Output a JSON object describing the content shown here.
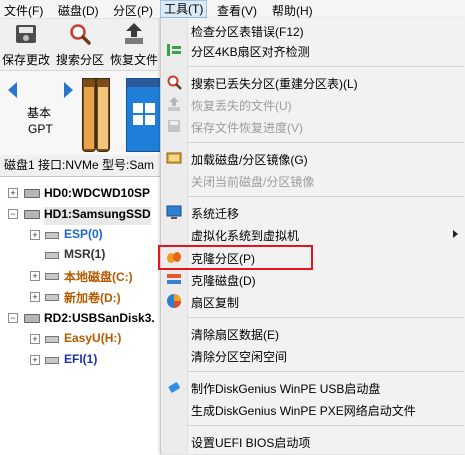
{
  "menubar": {
    "file": "文件(F)",
    "disk": "磁盘(D)",
    "partition": "分区(P)",
    "tools": "工具(T)",
    "view": "查看(V)",
    "help": "帮助(H)"
  },
  "toolbar": {
    "save": "保存更改",
    "search": "搜索分区",
    "restore": "恢复文件"
  },
  "disk_panel": {
    "basic": "基本",
    "gpt": "GPT",
    "info": "磁盘1 接口:NVMe  型号:Sam"
  },
  "tree": [
    {
      "label": "HD0:WDCWD10SP",
      "color": "#000000",
      "bold": true
    },
    {
      "label": "HD1:SamsungSSD",
      "color": "#000000",
      "bold": true
    },
    {
      "label": "ESP(0)",
      "color": "#1a66cc",
      "bold": true
    },
    {
      "label": "MSR(1)",
      "color": "#333333",
      "bold": true
    },
    {
      "label": "本地磁盘(C:)",
      "color": "#b65a00",
      "bold": true
    },
    {
      "label": "新加卷(D:)",
      "color": "#b65a00",
      "bold": true
    },
    {
      "label": "RD2:USBSanDisk3.",
      "color": "#000000",
      "bold": true
    },
    {
      "label": "EasyU(H:)",
      "color": "#b65a00",
      "bold": true
    },
    {
      "label": "EFI(1)",
      "color": "#1a33aa",
      "bold": true
    }
  ],
  "tools_menu": {
    "items": [
      {
        "label": "检查分区表错误(F12)",
        "icon": "",
        "disabled": false
      },
      {
        "label": "分区4KB扇区对齐检测",
        "icon": "align-icon",
        "disabled": false
      },
      {
        "label": "搜索已丢失分区(重建分区表)(L)",
        "icon": "search-icon",
        "disabled": false
      },
      {
        "label": "恢复丢失的文件(U)",
        "icon": "restore-icon",
        "disabled": true
      },
      {
        "label": "保存文件恢复进度(V)",
        "icon": "save-icon",
        "disabled": true
      },
      {
        "label": "加载磁盘/分区镜像(G)",
        "icon": "image-icon",
        "disabled": false
      },
      {
        "label": "关闭当前磁盘/分区镜像",
        "icon": "",
        "disabled": true
      },
      {
        "label": "系统迁移",
        "icon": "migrate-icon",
        "disabled": false
      },
      {
        "label": "虚拟化系统到虚拟机",
        "icon": "",
        "disabled": false,
        "submenu": true
      },
      {
        "label": "克隆分区(P)",
        "icon": "clone-partition-icon",
        "disabled": false
      },
      {
        "label": "克隆磁盘(D)",
        "icon": "clone-disk-icon",
        "disabled": false
      },
      {
        "label": "扇区复制",
        "icon": "sector-copy-icon",
        "disabled": false
      },
      {
        "label": "清除扇区数据(E)",
        "icon": "",
        "disabled": false
      },
      {
        "label": "清除分区空闲空间",
        "icon": "",
        "disabled": false
      },
      {
        "label": "制作DiskGenius WinPE USB启动盘",
        "icon": "usb-icon",
        "disabled": false
      },
      {
        "label": "生成DiskGenius WinPE PXE网络启动文件",
        "icon": "",
        "disabled": false
      },
      {
        "label": "设置UEFI BIOS启动项",
        "icon": "",
        "disabled": false
      }
    ]
  },
  "colors": {
    "highlight_box": "#e2161b",
    "accent": "#2a75c9"
  }
}
